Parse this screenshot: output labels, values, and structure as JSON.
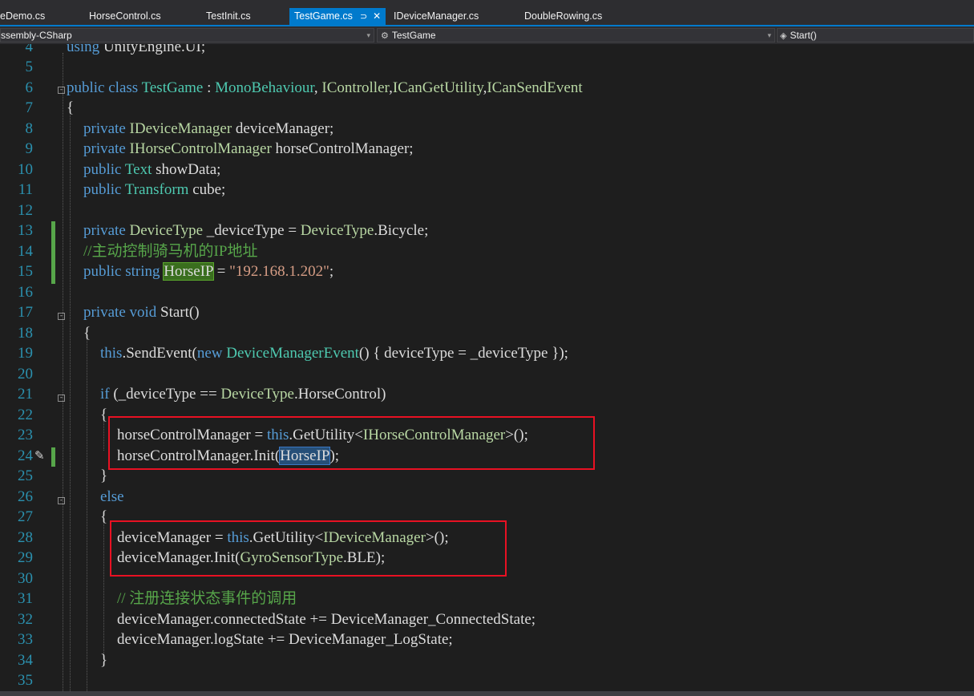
{
  "tabs": [
    {
      "label": "eDemo.cs",
      "active": false
    },
    {
      "label": "HorseControl.cs",
      "active": false
    },
    {
      "label": "TestInit.cs",
      "active": false
    },
    {
      "label": "TestGame.cs",
      "active": true
    },
    {
      "label": "IDeviceManager.cs",
      "active": false
    },
    {
      "label": "DoubleRowing.cs",
      "active": false
    }
  ],
  "tab_icons": {
    "pin": "⊃",
    "close": "✕"
  },
  "navbar": {
    "project": "ssembly-CSharp",
    "class_name": "TestGame",
    "member": "Start()"
  },
  "lines": [
    {
      "no": "4"
    },
    {
      "no": "5"
    },
    {
      "no": "6"
    },
    {
      "no": "7"
    },
    {
      "no": "8"
    },
    {
      "no": "9"
    },
    {
      "no": "10"
    },
    {
      "no": "11"
    },
    {
      "no": "12"
    },
    {
      "no": "13"
    },
    {
      "no": "14"
    },
    {
      "no": "15"
    },
    {
      "no": "16"
    },
    {
      "no": "17"
    },
    {
      "no": "18"
    },
    {
      "no": "19"
    },
    {
      "no": "20"
    },
    {
      "no": "21"
    },
    {
      "no": "22"
    },
    {
      "no": "23"
    },
    {
      "no": "24"
    },
    {
      "no": "25"
    },
    {
      "no": "26"
    },
    {
      "no": "27"
    },
    {
      "no": "28"
    },
    {
      "no": "29"
    },
    {
      "no": "30"
    },
    {
      "no": "31"
    },
    {
      "no": "32"
    },
    {
      "no": "33"
    },
    {
      "no": "34"
    },
    {
      "no": "35"
    }
  ],
  "code": {
    "l4": {
      "t1": "using",
      "t2": " UnityEngine.UI;"
    },
    "l6": {
      "t1": "public class ",
      "t2": "TestGame",
      "t3": " : ",
      "t4": "MonoBehaviour",
      "t5": ", ",
      "t6": "IController",
      "t7": ",",
      "t8": "ICanGetUtility",
      "t9": ",",
      "t10": "ICanSendEvent"
    },
    "l7": {
      "t1": "{"
    },
    "l8": {
      "t1": "private ",
      "t2": "IDeviceManager",
      "t3": " deviceManager;"
    },
    "l9": {
      "t1": "private ",
      "t2": "IHorseControlManager",
      "t3": " horseControlManager;"
    },
    "l10": {
      "t1": "public ",
      "t2": "Text",
      "t3": " showData;"
    },
    "l11": {
      "t1": "public ",
      "t2": "Transform",
      "t3": " cube;"
    },
    "l13": {
      "t1": "private ",
      "t2": "DeviceType",
      "t3": " _deviceType = ",
      "t4": "DeviceType",
      "t5": ".Bicycle;"
    },
    "l14": {
      "t1": "//主动控制骑马机的IP地址"
    },
    "l15": {
      "t1": "public string ",
      "t2": "HorseIP",
      "t3": " = ",
      "t4": "\"192.168.1.202\"",
      "t5": ";"
    },
    "l17": {
      "t1": "private void ",
      "t2": "Start()"
    },
    "l18": {
      "t1": "{"
    },
    "l19": {
      "t1": "this",
      "t2": ".SendEvent(",
      "t3": "new ",
      "t4": "DeviceManagerEvent",
      "t5": "() { deviceType = _deviceType });"
    },
    "l21": {
      "t1": "if",
      "t2": " (_deviceType == ",
      "t3": "DeviceType",
      "t4": ".HorseControl)"
    },
    "l22": {
      "t1": "{"
    },
    "l23": {
      "t1": "horseControlManager = ",
      "t2": "this",
      "t3": ".GetUtility<",
      "t4": "IHorseControlManager",
      "t5": ">();"
    },
    "l24": {
      "t1": "horseControlManager.Init(",
      "t2": "HorseIP",
      "t3": ");"
    },
    "l25": {
      "t1": "}"
    },
    "l26": {
      "t1": "else"
    },
    "l27": {
      "t1": "{"
    },
    "l28": {
      "t1": "deviceManager = ",
      "t2": "this",
      "t3": ".GetUtility<",
      "t4": "IDeviceManager",
      "t5": ">();"
    },
    "l29": {
      "t1": "deviceManager.Init(",
      "t2": "GyroSensorType",
      "t3": ".BLE);"
    },
    "l31": {
      "t1": "// 注册连接状态事件的调用"
    },
    "l32": {
      "t1": "deviceManager.connectedState += DeviceManager_ConnectedState;"
    },
    "l33": {
      "t1": "deviceManager.logState += DeviceManager_LogState;"
    },
    "l34": {
      "t1": "}"
    }
  },
  "colors": {
    "keyword": "#569cd6",
    "type": "#4ec9b0",
    "interface": "#b8d7a3",
    "string": "#d69d85",
    "comment": "#57a64a",
    "line_number": "#2b91af",
    "annotation_box": "#e81123",
    "accent": "#007acc"
  },
  "icons": {
    "fold": "collapse-icon",
    "brush": "paintbrush-icon"
  }
}
